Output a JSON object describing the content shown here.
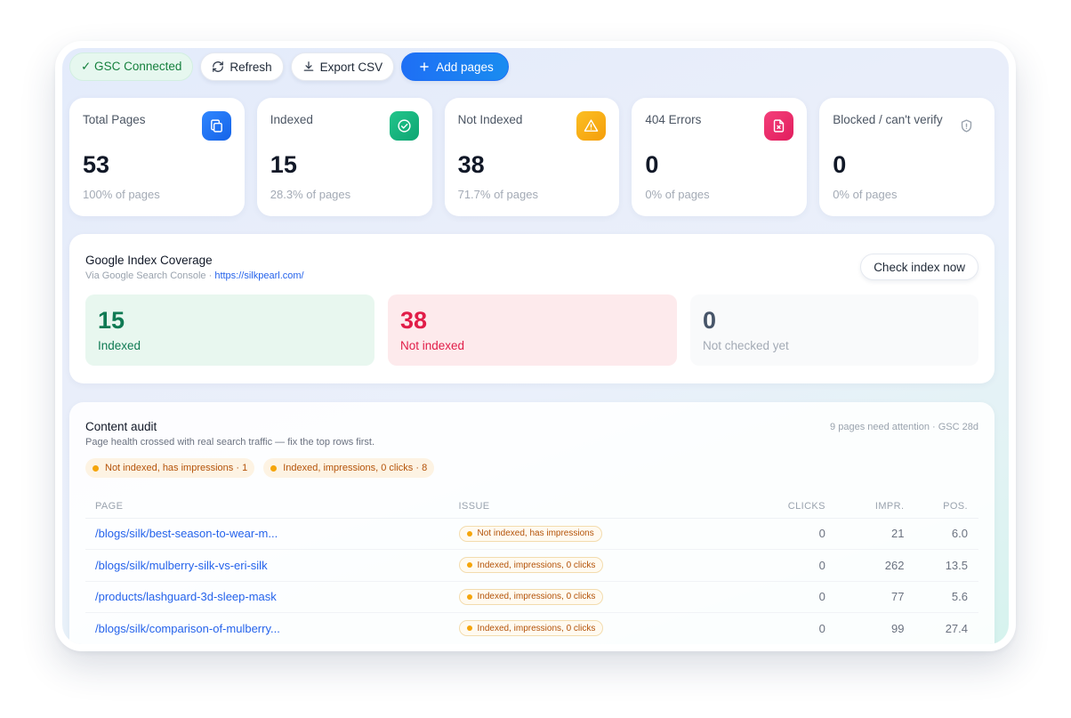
{
  "toolbar": {
    "status_label": "✓ GSC Connected",
    "refresh_label": "Refresh",
    "export_label": "Export CSV",
    "add_label": "Add pages"
  },
  "stats": [
    {
      "label": "Total Pages",
      "value": "53",
      "sub": "100% of pages",
      "icon": "copy-icon"
    },
    {
      "label": "Indexed",
      "value": "15",
      "sub": "28.3% of pages",
      "icon": "check-circle-icon"
    },
    {
      "label": "Not Indexed",
      "value": "38",
      "sub": "71.7% of pages",
      "icon": "warning-icon"
    },
    {
      "label": "404 Errors",
      "value": "0",
      "sub": "0% of pages",
      "icon": "file-x-icon"
    },
    {
      "label": "Blocked / can't verify",
      "value": "0",
      "sub": "0% of pages",
      "icon": "shield-icon"
    }
  ],
  "coverage": {
    "title": "Google Index Coverage",
    "source_prefix": "Via Google Search Console · ",
    "source_url": "https://silkpearl.com/",
    "check_label": "Check index now",
    "indexed": {
      "value": "15",
      "label": "Indexed"
    },
    "not_indexed": {
      "value": "38",
      "label": "Not indexed"
    },
    "not_checked": {
      "value": "0",
      "label": "Not checked yet"
    }
  },
  "audit": {
    "title": "Content audit",
    "description": "Page health crossed with real search traffic — fix the top rows first.",
    "meta": "9 pages need attention · GSC 28d",
    "chips": [
      "Not indexed, has impressions · 1",
      "Indexed, impressions, 0 clicks · 8"
    ],
    "columns": [
      "PAGE",
      "ISSUE",
      "CLICKS",
      "IMPR.",
      "POS."
    ],
    "rows": [
      {
        "page": "/blogs/silk/best-season-to-wear-m...",
        "issue": "Not indexed, has impressions",
        "clicks": "0",
        "impr": "21",
        "pos": "6.0"
      },
      {
        "page": "/blogs/silk/mulberry-silk-vs-eri-silk",
        "issue": "Indexed, impressions, 0 clicks",
        "clicks": "0",
        "impr": "262",
        "pos": "13.5"
      },
      {
        "page": "/products/lashguard-3d-sleep-mask",
        "issue": "Indexed, impressions, 0 clicks",
        "clicks": "0",
        "impr": "77",
        "pos": "5.6"
      },
      {
        "page": "/blogs/silk/comparison-of-mulberry...",
        "issue": "Indexed, impressions, 0 clicks",
        "clicks": "0",
        "impr": "99",
        "pos": "27.4"
      }
    ]
  }
}
